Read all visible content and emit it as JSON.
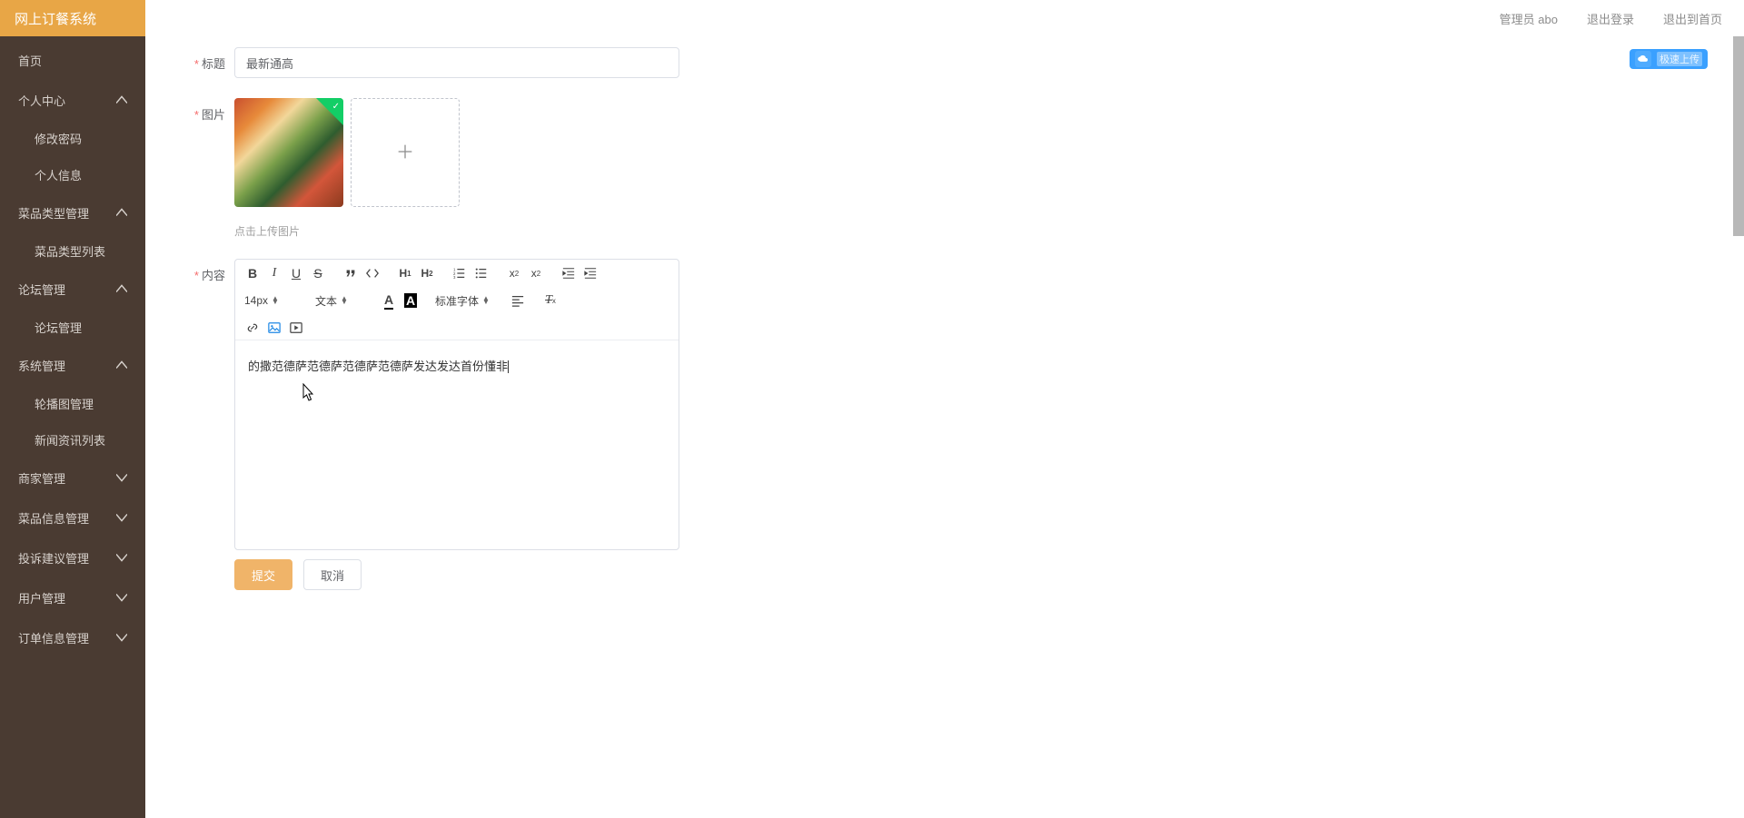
{
  "brand": {
    "title": "网上订餐系统"
  },
  "topbar": {
    "user": "管理员 abo",
    "logout": "退出登录",
    "home": "退出到首页"
  },
  "sidebar": {
    "home": "首页",
    "groups": [
      {
        "label": "个人中心",
        "open": true,
        "subs": [
          "修改密码",
          "个人信息"
        ]
      },
      {
        "label": "菜品类型管理",
        "open": true,
        "subs": [
          "菜品类型列表"
        ]
      },
      {
        "label": "论坛管理",
        "open": true,
        "subs": [
          "论坛管理"
        ]
      },
      {
        "label": "系统管理",
        "open": true,
        "subs": [
          "轮播图管理",
          "新闻资讯列表"
        ]
      },
      {
        "label": "商家管理",
        "open": false,
        "subs": []
      },
      {
        "label": "菜品信息管理",
        "open": false,
        "subs": []
      },
      {
        "label": "投诉建议管理",
        "open": false,
        "subs": []
      },
      {
        "label": "用户管理",
        "open": false,
        "subs": []
      },
      {
        "label": "订单信息管理",
        "open": false,
        "subs": []
      }
    ]
  },
  "form": {
    "title_label": "标题",
    "title_value": "最新通高",
    "image_label": "图片",
    "upload_tip": "点击上传图片",
    "content_label": "内容",
    "content_text": "的撒范德萨范德萨范德萨范德萨发达发达首份懂非",
    "submit": "提交",
    "cancel": "取消"
  },
  "editor": {
    "font_size": "14px",
    "paragraph": "文本",
    "font_family": "标准字体"
  },
  "cloud": {
    "label": "极速上传"
  }
}
